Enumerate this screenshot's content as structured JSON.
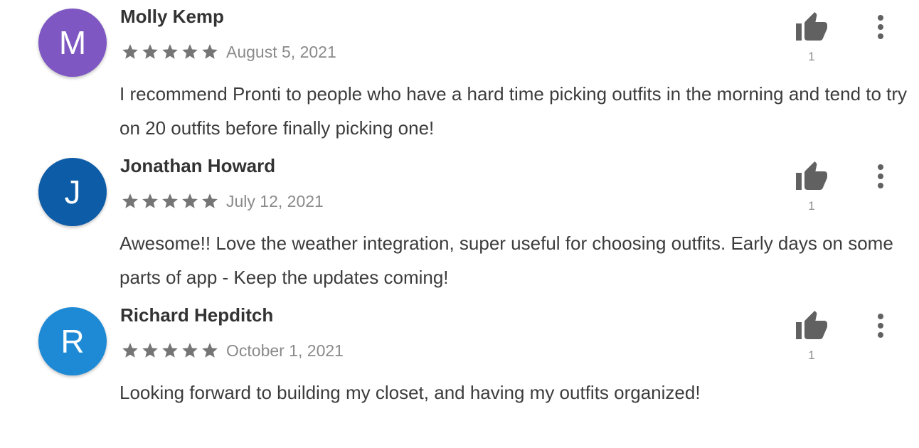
{
  "reviews": [
    {
      "initial": "M",
      "avatar_color": "#7e57c2",
      "name": "Molly Kemp",
      "rating": 5,
      "date": "August 5, 2021",
      "text": "I recommend Pronti to people who have a hard time picking outfits in the morning and tend to try on 20 outfits before finally picking one!",
      "helpful_count": "1"
    },
    {
      "initial": "J",
      "avatar_color": "#0d5ca8",
      "name": "Jonathan Howard",
      "rating": 5,
      "date": "July 12, 2021",
      "text": "Awesome!! Love the weather integration, super useful for choosing outfits. Early days on some parts of app - Keep the updates coming!",
      "helpful_count": "1"
    },
    {
      "initial": "R",
      "avatar_color": "#1e8ad6",
      "name": "Richard Hepditch",
      "rating": 5,
      "date": "October 1, 2021",
      "text": "Looking forward to building my closet, and having my outfits organized!",
      "helpful_count": "1"
    }
  ],
  "colors": {
    "star": "#757575",
    "icon": "#616161"
  },
  "icons": {
    "star": "star-icon",
    "helpful": "thumb-up-icon",
    "more": "more-vert-icon"
  }
}
